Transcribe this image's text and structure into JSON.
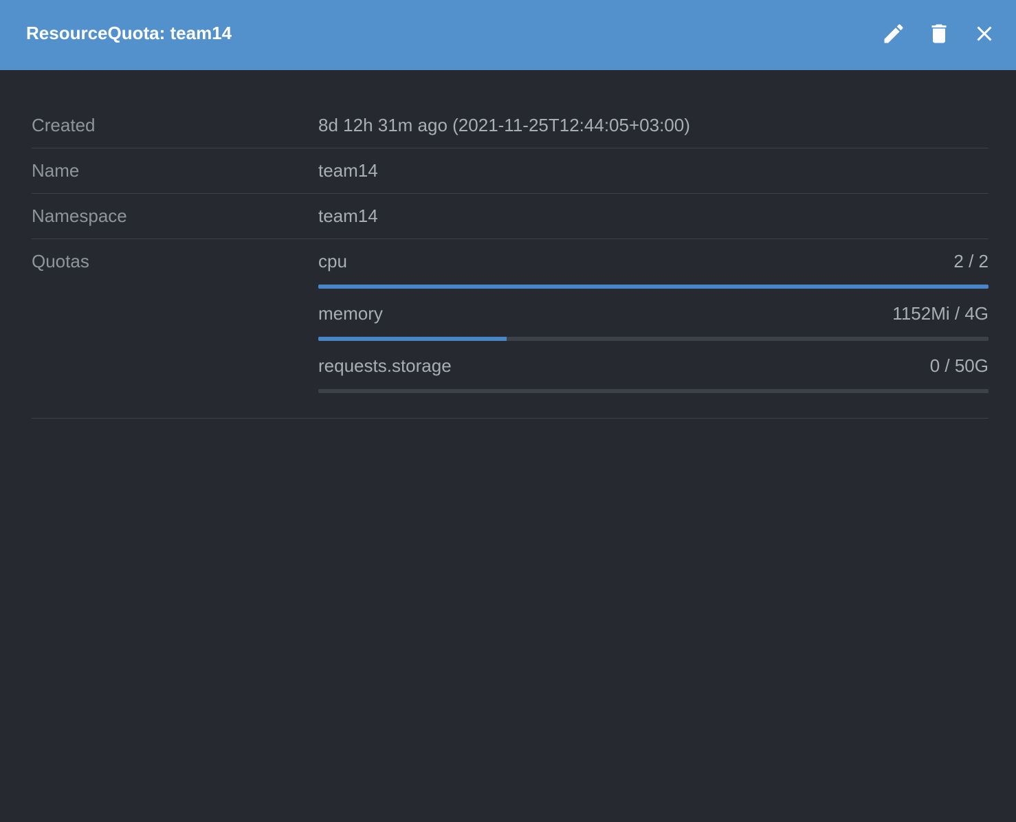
{
  "header": {
    "title": "ResourceQuota: team14",
    "actions": [
      {
        "name": "edit",
        "icon": "pencil-icon"
      },
      {
        "name": "delete",
        "icon": "trash-icon"
      },
      {
        "name": "close",
        "icon": "close-icon"
      }
    ]
  },
  "details": {
    "created": {
      "label": "Created",
      "value": "8d 12h 31m ago (2021-11-25T12:44:05+03:00)"
    },
    "name": {
      "label": "Name",
      "value": "team14"
    },
    "namespace": {
      "label": "Namespace",
      "value": "team14"
    },
    "quotas_label": "Quotas"
  },
  "quotas": [
    {
      "name": "cpu",
      "usage": "2 / 2",
      "fraction": 1.0
    },
    {
      "name": "memory",
      "usage": "1152Mi / 4G",
      "fraction": 0.281
    },
    {
      "name": "requests.storage",
      "usage": "0 / 50G",
      "fraction": 0.0
    }
  ],
  "colors": {
    "header": "#5291cc",
    "background": "#262a30",
    "bar_fill": "#4a85c8",
    "bar_track": "#3d4249"
  }
}
